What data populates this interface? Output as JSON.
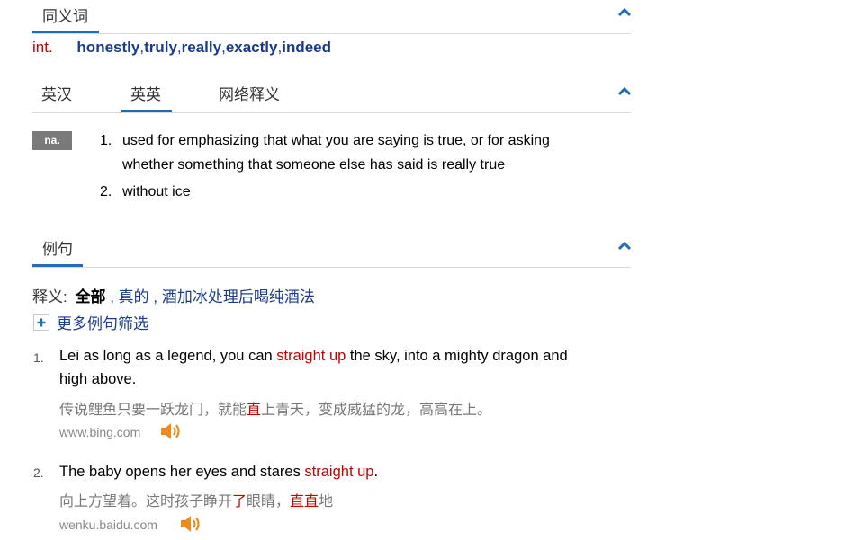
{
  "synonyms": {
    "title": "同义词",
    "pos": "int.",
    "words": [
      "honestly",
      "truly",
      "really",
      "exactly",
      "indeed"
    ]
  },
  "tabs": {
    "items": [
      "英汉",
      "英英",
      "网络释义"
    ],
    "active_index": 1
  },
  "en_en": {
    "pos_badge": "na.",
    "definitions": [
      {
        "num": "1.",
        "line1": "used for emphasizing that what you are saying is true, or for asking",
        "line2": "whether something that someone else has said is really true"
      },
      {
        "num": "2.",
        "line1": "without ice"
      }
    ]
  },
  "examples": {
    "title": "例句",
    "filter": {
      "label": "释义:",
      "all": "全部",
      "sep1": ",",
      "opt1": "真的",
      "sep2": ",",
      "opt2": "酒加冰处理后喝纯酒法"
    },
    "more_label": "更多例句筛选",
    "items": [
      {
        "num": "1.",
        "en_pre": "Lei as long as a legend, you can ",
        "en_hl": "straight up",
        "en_post_1": " the sky, into a mighty dragon and",
        "en_line2": "high above.",
        "cn_pre": "传说鲤鱼只要一跃龙门，就能",
        "cn_hl": "直",
        "cn_post": "上青天，变成威猛的龙，高高在上。",
        "source": "www.bing.com"
      },
      {
        "num": "2.",
        "en_pre": "The baby opens her eyes and stares ",
        "en_hl": "straight up",
        "en_post": ".",
        "cn_pre": "向上方望着。这时孩子睁开",
        "cn_hl1": "了",
        "cn_mid": "眼睛，",
        "cn_hl2": "直直",
        "cn_post": "地",
        "source": "wenku.baidu.com"
      }
    ]
  },
  "colors": {
    "accent_blue": "#1f6eb7",
    "highlight_red": "#c40000",
    "speaker_orange": "#f08a1c"
  }
}
